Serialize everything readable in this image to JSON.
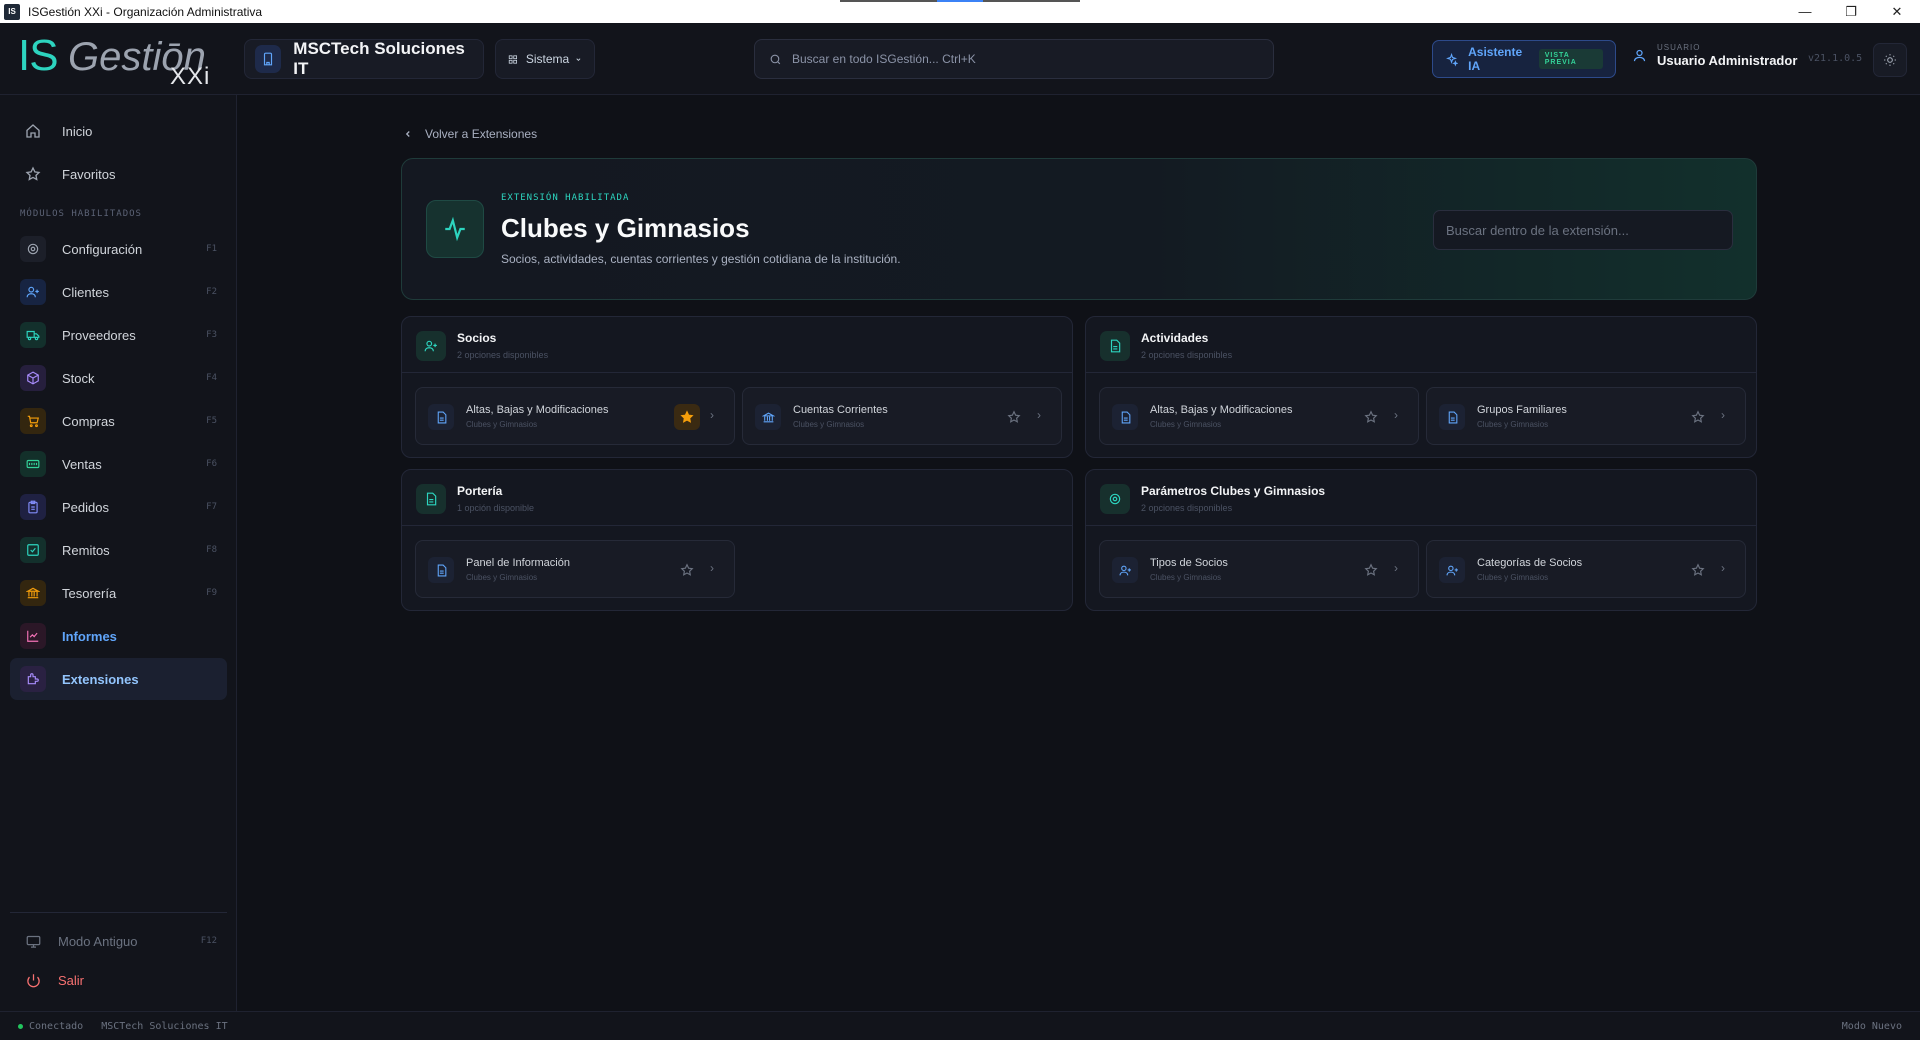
{
  "window": {
    "title": "ISGestión XXi - Organización Administrativa",
    "app_icon": "IS",
    "minimize": "—",
    "restore": "❐",
    "close": "✕"
  },
  "header": {
    "logo_is": "IS",
    "logo_gestion": "Gestiōn",
    "logo_xxi": "XXi",
    "company": "MSCTech Soluciones IT",
    "sistema_label": "Sistema",
    "search_placeholder": "Buscar en todo ISGestión... Ctrl+K",
    "ai_label": "Asistente IA",
    "ai_badge": "VISTA PREVIA",
    "user_label": "USUARIO",
    "user_name": "Usuario Administrador",
    "version": "v21.1.0.5"
  },
  "sidebar": {
    "top_items": [
      {
        "label": "Inicio",
        "icon": "home-icon"
      },
      {
        "label": "Favoritos",
        "icon": "star-icon"
      }
    ],
    "section_label": "MÓDULOS HABILITADOS",
    "modules": [
      {
        "label": "Configuración",
        "key": "F1",
        "color": "#9ca3af"
      },
      {
        "label": "Clientes",
        "key": "F2",
        "color": "#60a5fa"
      },
      {
        "label": "Proveedores",
        "key": "F3",
        "color": "#2dd4bf"
      },
      {
        "label": "Stock",
        "key": "F4",
        "color": "#a78bfa"
      },
      {
        "label": "Compras",
        "key": "F5",
        "color": "#f59e0b"
      },
      {
        "label": "Ventas",
        "key": "F6",
        "color": "#34d399"
      },
      {
        "label": "Pedidos",
        "key": "F7",
        "color": "#818cf8"
      },
      {
        "label": "Remitos",
        "key": "F8",
        "color": "#2dd4bf"
      },
      {
        "label": "Tesorería",
        "key": "F9",
        "color": "#f59e0b"
      },
      {
        "label": "Informes",
        "key": "",
        "color": "#f472b6"
      },
      {
        "label": "Extensiones",
        "key": "",
        "color": "#a78bfa"
      }
    ],
    "bottom_items": [
      {
        "label": "Modo Antiguo",
        "key": "F12"
      },
      {
        "label": "Salir",
        "key": ""
      }
    ]
  },
  "status": {
    "connection": "Conectado",
    "company": "MSCTech Soluciones IT",
    "mode": "Modo Nuevo"
  },
  "main": {
    "back_label": "Volver a Extensiones",
    "eyebrow": "EXTENSIÓN HABILITADA",
    "title": "Clubes y Gimnasios",
    "description": "Socios, actividades, cuentas corrientes y gestión cotidiana de la institución.",
    "search_placeholder": "Buscar dentro de la extensión...",
    "groups": [
      {
        "title": "Socios",
        "subtitle": "2 opciones disponibles",
        "options": [
          {
            "title": "Altas, Bajas y Modificaciones",
            "sub": "Clubes y Gimnasios",
            "favorite": true
          },
          {
            "title": "Cuentas Corrientes",
            "sub": "Clubes y Gimnasios",
            "favorite": false
          }
        ]
      },
      {
        "title": "Actividades",
        "subtitle": "2 opciones disponibles",
        "options": [
          {
            "title": "Altas, Bajas y Modificaciones",
            "sub": "Clubes y Gimnasios",
            "favorite": false
          },
          {
            "title": "Grupos Familiares",
            "sub": "Clubes y Gimnasios",
            "favorite": false
          }
        ]
      },
      {
        "title": "Portería",
        "subtitle": "1 opción disponible",
        "options": [
          {
            "title": "Panel de Información",
            "sub": "Clubes y Gimnasios",
            "favorite": false
          }
        ]
      },
      {
        "title": "Parámetros Clubes y Gimnasios",
        "subtitle": "2 opciones disponibles",
        "options": [
          {
            "title": "Tipos de Socios",
            "sub": "Clubes y Gimnasios",
            "favorite": false
          },
          {
            "title": "Categorías de Socios",
            "sub": "Clubes y Gimnasios",
            "favorite": false
          }
        ]
      }
    ]
  }
}
